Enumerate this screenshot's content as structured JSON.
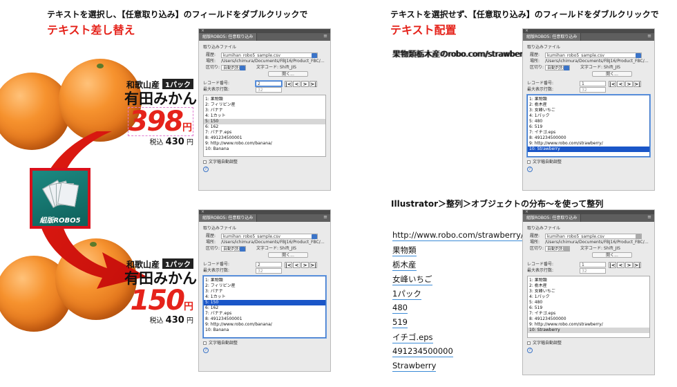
{
  "left": {
    "caption_black": "テキストを選択し、【任意取り込み】のフィールドをダブルクリックで",
    "caption_red": "テキスト差し替え"
  },
  "right": {
    "caption_black": "テキストを選択せず、【任意取り込み】のフィールドをダブルクリックで",
    "caption_red": "テキスト配置",
    "overlap_text": "果物類栃木産のrobo.com/strawberry/",
    "align_caption": "Illustrator＞整列＞オブジェクトの分布〜を使って整列",
    "distributed": [
      "http://www.robo.com/strawberry/",
      "果物類",
      "栃木産",
      "女峰いちご",
      "1パック",
      "480",
      "519",
      "イチゴ.eps",
      "491234500000",
      "Strawberry"
    ]
  },
  "price_top": {
    "origin": "和歌山産",
    "pack": "1パック",
    "name": "有田みかん",
    "price": "398",
    "yen": "円",
    "tax_label": "税込",
    "tax_price": "430",
    "tax_yen": "円"
  },
  "price_bottom": {
    "origin": "和歌山産",
    "pack": "1パック",
    "name": "有田みかん",
    "price": "150",
    "yen": "円",
    "tax_label": "税込",
    "tax_price": "430",
    "tax_yen": "円"
  },
  "logo": {
    "label": "組版ROBO5"
  },
  "panel_common": {
    "tab": "組版ROBO5: 任意取り込み",
    "section": "取り込みファイル",
    "history_label": "履歴:",
    "history_value": "kumihan_robo5_sample.csv",
    "location_label": "場所:",
    "location_value": "/Users/ichimura/Documents/FBJ16/Product_FBC/…",
    "delimiter_label": "区切り:",
    "delimiter_value": "自動判別",
    "encoding": "文字コード: Shift_JIS",
    "open_button": "開く...",
    "record_label": "レコード番号:",
    "max_label": "最大表示行数:",
    "max_value": "32",
    "autofit": "文字幅自動調整",
    "help": "?"
  },
  "panel1": {
    "record": "2",
    "items": [
      "1: 果物類",
      "2: フィリピン産",
      "3: バナナ",
      "4: 1カット",
      "5: 150",
      "6: 162",
      "7: バナナ.eps",
      "8: 491234500001",
      "9: http://www.robo.com/banana/",
      "10: Banana"
    ]
  },
  "panel2": {
    "record": "2",
    "items": [
      "1: 果物類",
      "2: フィリピン産",
      "3: バナナ",
      "4: 1カット",
      "5: 150",
      "6: 162",
      "7: バナナ.eps",
      "8: 491234500001",
      "9: http://www.robo.com/banana/",
      "10: Banana"
    ]
  },
  "panel3": {
    "record": "1",
    "items": [
      "1: 果物類",
      "2: 栃木産",
      "3: 女峰いちご",
      "4: 1パック",
      "5: 480",
      "6: 519",
      "7: イチゴ.eps",
      "8: 491234500000",
      "9: http://www.robo.com/strawberry/",
      "10: Strawberry"
    ]
  },
  "panel4": {
    "record": "1",
    "items": [
      "1: 果物類",
      "2: 栃木産",
      "3: 女峰いちご",
      "4: 1パック",
      "5: 480",
      "6: 519",
      "7: イチゴ.eps",
      "8: 491234500000",
      "9: http://www.robo.com/strawberry/",
      "10: Strawberry"
    ]
  },
  "nav": [
    "K",
    "<",
    ">",
    "K"
  ],
  "colors": {
    "accent_red": "#e5231b",
    "select_blue": "#1a56c8",
    "panel_bg": "#eaeaea"
  }
}
